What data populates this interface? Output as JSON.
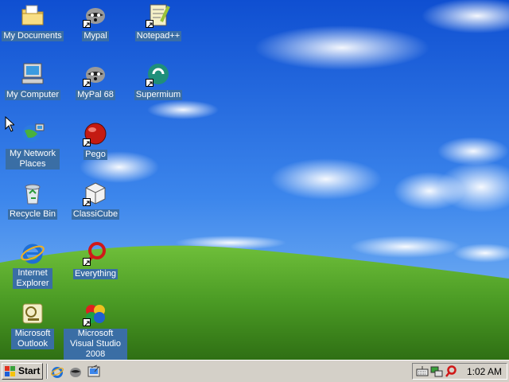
{
  "desktop": {
    "icons": [
      {
        "label": "My Documents",
        "icon": "folder-documents-icon"
      },
      {
        "label": "My Computer",
        "icon": "computer-icon"
      },
      {
        "label": "My Network Places",
        "icon": "network-places-icon"
      },
      {
        "label": "Recycle Bin",
        "icon": "recycle-bin-icon"
      },
      {
        "label": "Internet Explorer",
        "icon": "internet-explorer-icon"
      },
      {
        "label": "Microsoft Outlook",
        "icon": "outlook-icon"
      },
      {
        "label": "Mypal",
        "icon": "mypal-raccoon-icon"
      },
      {
        "label": "MyPal 68",
        "icon": "mypal-raccoon-icon"
      },
      {
        "label": "Pego",
        "icon": "pego-red-ball-icon"
      },
      {
        "label": "ClassiCube",
        "icon": "classicube-cube-icon"
      },
      {
        "label": "Everything",
        "icon": "everything-magnifier-icon"
      },
      {
        "label": "Microsoft Visual Studio 2008",
        "icon": "visual-studio-icon"
      },
      {
        "label": "Notepad++",
        "icon": "notepad-plus-plus-icon"
      },
      {
        "label": "Supermium",
        "icon": "supermium-icon"
      }
    ]
  },
  "taskbar": {
    "start_label": "Start",
    "quick_launch": [
      "internet-explorer-icon",
      "mypal-raccoon-icon",
      "show-desktop-icon"
    ],
    "tray_icons": [
      "keyboard-icon",
      "network-icon",
      "search-magnifier-icon"
    ],
    "clock": "1:02 AM"
  },
  "colors": {
    "sky": "#1a5fd8",
    "grass": "#4f9a2a",
    "icon_label_bg": "#3a6ea5",
    "taskbar": "#d4d0c8"
  }
}
